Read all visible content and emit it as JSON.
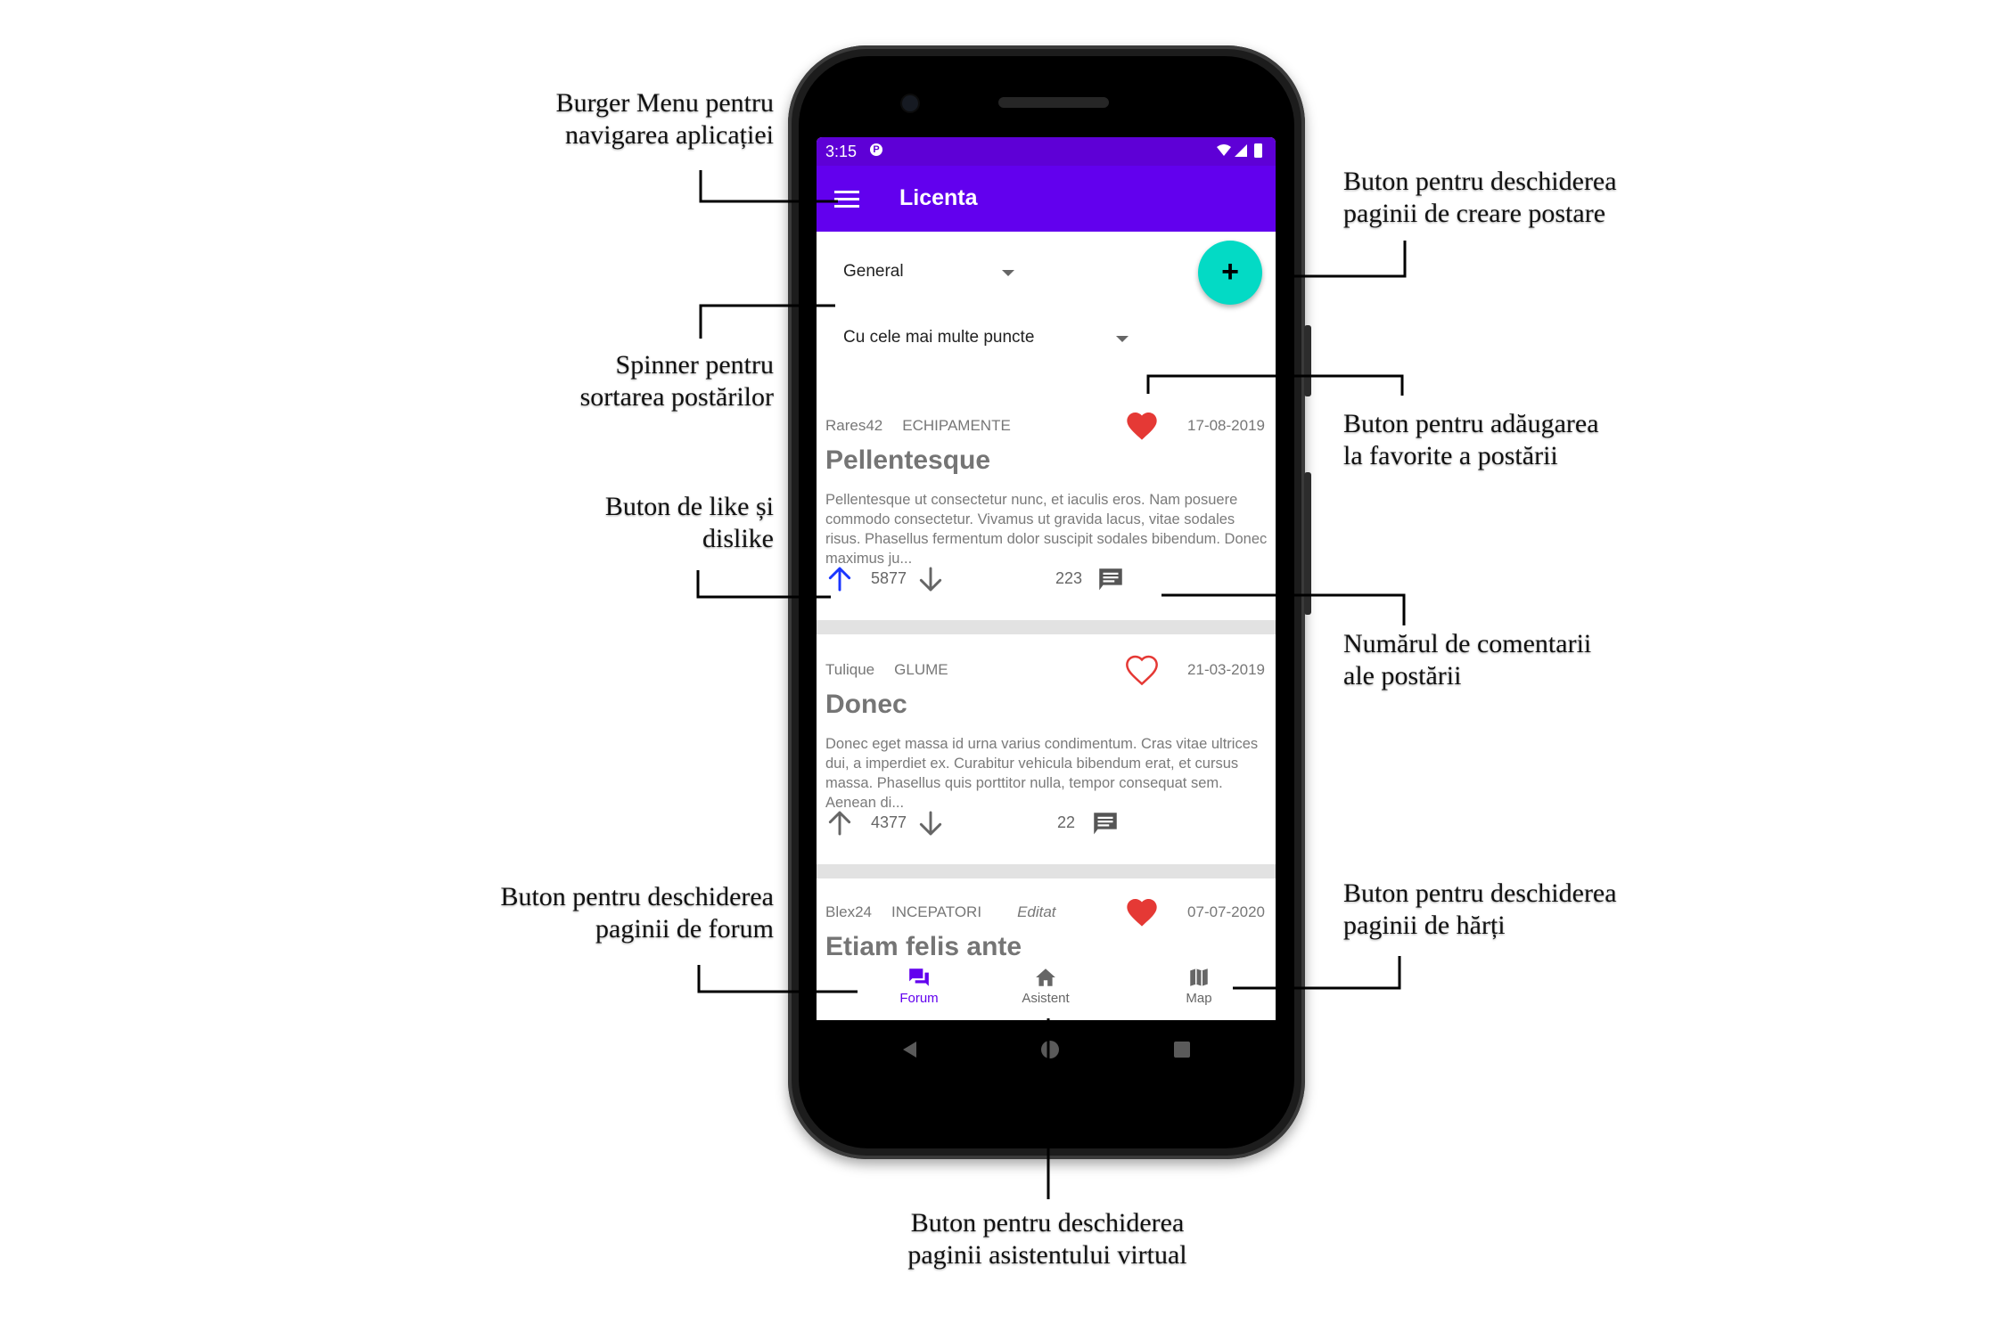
{
  "colors": {
    "status_bar": "#5e00d6",
    "app_bar": "#6200ee",
    "fab": "#03dac5",
    "heart": "#e53935",
    "upvote_active": "#1a36ff",
    "nav_active": "#6200ee"
  },
  "annotations": {
    "burger": [
      "Burger Menu pentru",
      "navigarea aplicației"
    ],
    "spinner": [
      "Spinner pentru",
      "sortarea postărilor"
    ],
    "like": [
      "Buton de like și",
      "dislike"
    ],
    "forum": [
      "Buton pentru deschiderea",
      "paginii de forum"
    ],
    "create": [
      "Buton pentru deschiderea",
      "paginii de creare postare"
    ],
    "favorite": [
      "Buton pentru adăugarea",
      "la favorite a postării"
    ],
    "comments": [
      "Numărul de comentarii",
      "ale postării"
    ],
    "map": [
      "Buton pentru deschiderea",
      "paginii de hărți"
    ],
    "assistant": [
      "Buton pentru deschiderea",
      "paginii asistentului virtual"
    ]
  },
  "status_bar": {
    "time": "3:15",
    "icons": [
      "wifi-icon",
      "signal-icon",
      "battery-icon"
    ]
  },
  "app_bar": {
    "title": "Licenta",
    "menu_icon": "burger-menu-icon"
  },
  "filters": {
    "category": "General",
    "sort": "Cu cele mai multe puncte"
  },
  "fab": {
    "label": "+",
    "icon": "plus-icon"
  },
  "posts": [
    {
      "author": "Rares42",
      "category": "ECHIPAMENTE",
      "date": "17-08-2019",
      "favorite": true,
      "title": "Pellentesque",
      "body": "Pellentesque ut consectetur nunc, et iaculis eros. Nam posuere commodo consectetur. Vivamus ut gravida lacus, vitae sodales risus. Phasellus fermentum dolor suscipit sodales bibendum. Donec maximus ju...",
      "score": "5877",
      "upvoted": true,
      "comments": "223"
    },
    {
      "author": "Tulique",
      "category": "GLUME",
      "date": "21-03-2019",
      "favorite": false,
      "title": "Donec",
      "body": "Donec eget massa id urna varius condimentum. Cras vitae ultrices dui, a imperdiet ex. Curabitur vehicula bibendum erat, et cursus massa. Phasellus quis porttitor nulla, tempor consequat sem. Aenean di...",
      "score": "4377",
      "upvoted": false,
      "comments": "22"
    },
    {
      "author": "Blex24",
      "category": "INCEPATORI",
      "edited": "Editat",
      "date": "07-07-2020",
      "favorite": true,
      "title": "Etiam felis ante"
    }
  ],
  "bottom_nav": [
    {
      "label": "Forum",
      "icon": "forum-icon",
      "active": true
    },
    {
      "label": "Asistent",
      "icon": "home-icon",
      "active": false
    },
    {
      "label": "Map",
      "icon": "map-icon",
      "active": false
    }
  ],
  "system_nav": [
    "back-icon",
    "home-circle-icon",
    "recents-icon"
  ]
}
